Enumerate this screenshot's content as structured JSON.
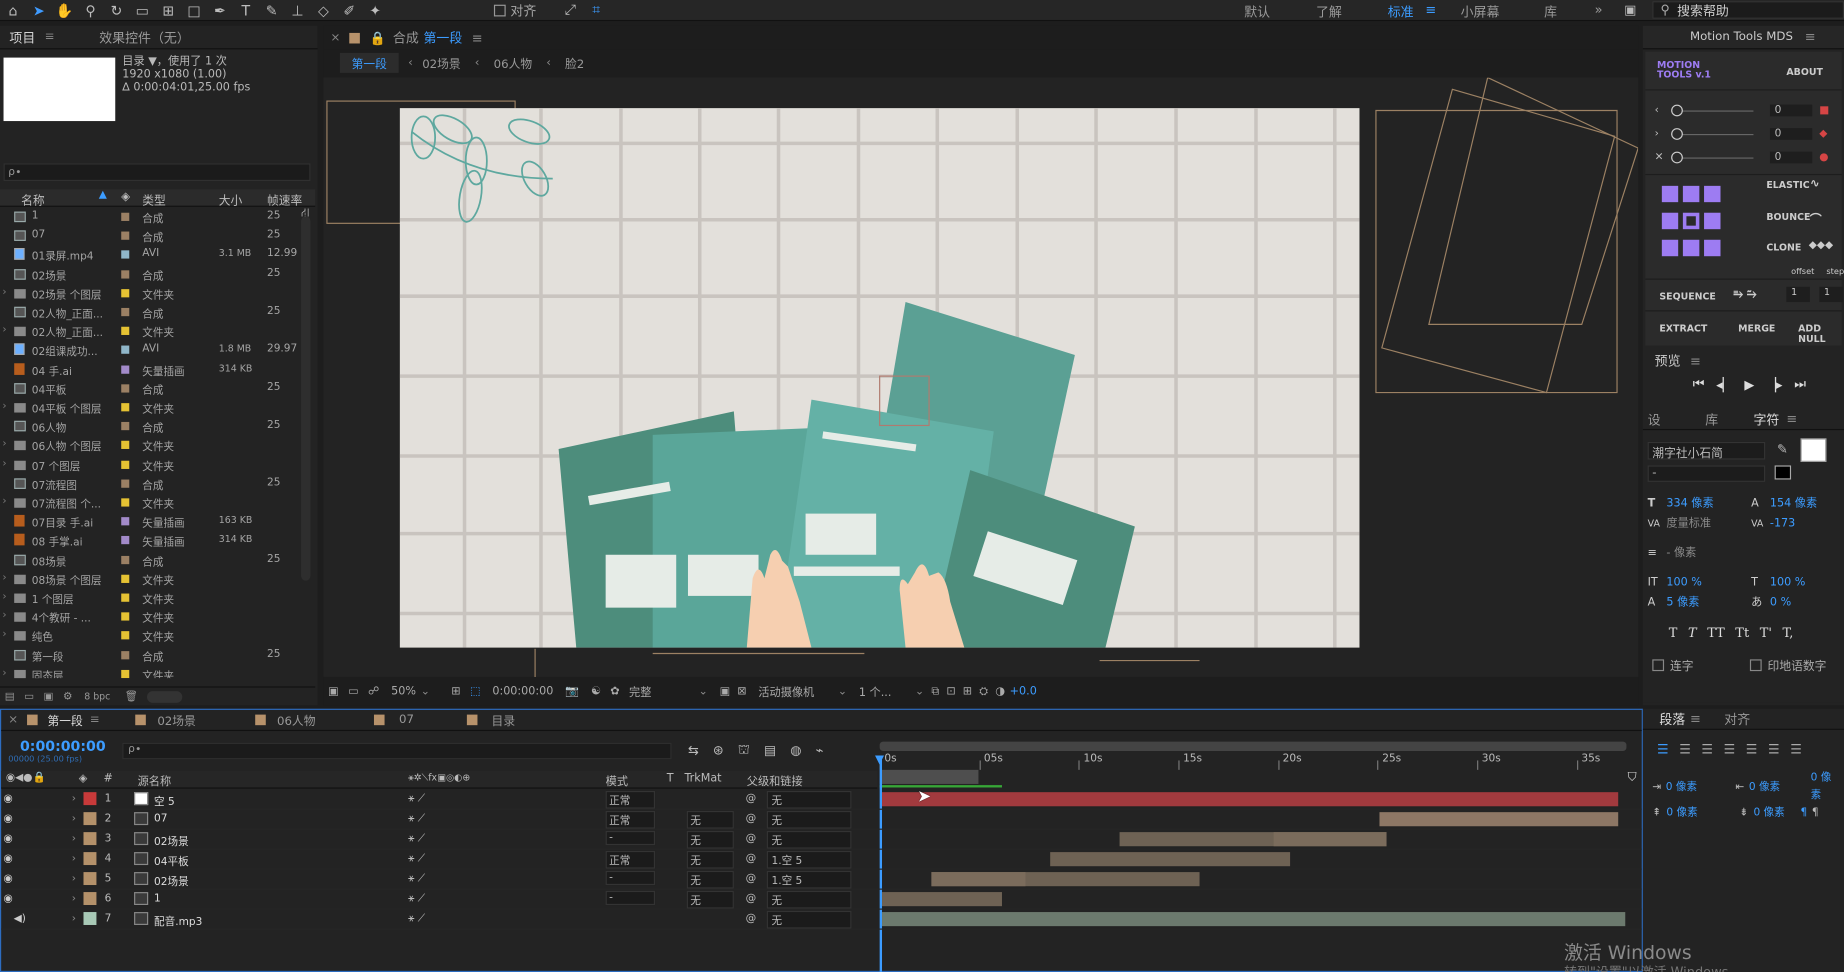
{
  "toolbar": {
    "snap_label": "对齐",
    "workspaces": [
      "默认",
      "了解",
      "标准",
      "小屏幕",
      "库"
    ],
    "search_placeholder": "搜索帮助"
  },
  "project_panel": {
    "tab_project": "项目",
    "tab_effects": "效果控件（无）",
    "comp_name": "目录 ▼，使用了 1 次",
    "comp_res": "1920 x1080 (1.00)",
    "comp_dur": "∆ 0:00:04:01,25.00 fps",
    "search_placeholder": "ρ∙",
    "columns": [
      "名称",
      "类型",
      "大小",
      "帧速率"
    ],
    "items": [
      {
        "name": "1",
        "icon": "comp",
        "color": "#9b8064",
        "type": "合成",
        "size": "",
        "fps": "25"
      },
      {
        "name": "07",
        "icon": "comp",
        "color": "#9b8064",
        "type": "合成",
        "size": "",
        "fps": "25"
      },
      {
        "name": "01录屏.mp4",
        "icon": "file",
        "color": "#8fb6c9",
        "type": "AVI",
        "size": "3.1 MB",
        "fps": "12.99"
      },
      {
        "name": "02场景",
        "icon": "comp",
        "color": "#9b8064",
        "type": "合成",
        "size": "",
        "fps": "25"
      },
      {
        "name": "02场景 个图层",
        "icon": "folder",
        "color": "#e5c233",
        "type": "文件夹",
        "size": "",
        "fps": ""
      },
      {
        "name": "02人物_正面...",
        "icon": "comp",
        "color": "#9b8064",
        "type": "合成",
        "size": "",
        "fps": "25"
      },
      {
        "name": "02人物_正面...",
        "icon": "folder",
        "color": "#e5c233",
        "type": "文件夹",
        "size": "",
        "fps": ""
      },
      {
        "name": "02组课成功...",
        "icon": "file",
        "color": "#8fb6c9",
        "type": "AVI",
        "size": "1.8 MB",
        "fps": "29.97"
      },
      {
        "name": "04 手.ai",
        "icon": "ai",
        "color": "#a28ac9",
        "type": "矢量插画",
        "size": "314 KB",
        "fps": ""
      },
      {
        "name": "04平板",
        "icon": "comp",
        "color": "#9b8064",
        "type": "合成",
        "size": "",
        "fps": "25"
      },
      {
        "name": "04平板 个图层",
        "icon": "folder",
        "color": "#e5c233",
        "type": "文件夹",
        "size": "",
        "fps": ""
      },
      {
        "name": "06人物",
        "icon": "comp",
        "color": "#9b8064",
        "type": "合成",
        "size": "",
        "fps": "25"
      },
      {
        "name": "06人物 个图层",
        "icon": "folder",
        "color": "#e5c233",
        "type": "文件夹",
        "size": "",
        "fps": ""
      },
      {
        "name": "07 个图层",
        "icon": "folder",
        "color": "#e5c233",
        "type": "文件夹",
        "size": "",
        "fps": ""
      },
      {
        "name": "07流程图",
        "icon": "comp",
        "color": "#9b8064",
        "type": "合成",
        "size": "",
        "fps": "25"
      },
      {
        "name": "07流程图 个...",
        "icon": "folder",
        "color": "#e5c233",
        "type": "文件夹",
        "size": "",
        "fps": ""
      },
      {
        "name": "07目录 手.ai",
        "icon": "ai",
        "color": "#a28ac9",
        "type": "矢量插画",
        "size": "163 KB",
        "fps": ""
      },
      {
        "name": "08 手掌.ai",
        "icon": "ai",
        "color": "#a28ac9",
        "type": "矢量插画",
        "size": "314 KB",
        "fps": ""
      },
      {
        "name": "08场景",
        "icon": "comp",
        "color": "#9b8064",
        "type": "合成",
        "size": "",
        "fps": "25"
      },
      {
        "name": "08场景 个图层",
        "icon": "folder",
        "color": "#e5c233",
        "type": "文件夹",
        "size": "",
        "fps": ""
      },
      {
        "name": "1 个图层",
        "icon": "folder",
        "color": "#e5c233",
        "type": "文件夹",
        "size": "",
        "fps": ""
      },
      {
        "name": "4个教研 - ...",
        "icon": "folder",
        "color": "#e5c233",
        "type": "文件夹",
        "size": "",
        "fps": ""
      },
      {
        "name": "纯色",
        "icon": "folder",
        "color": "#e5c233",
        "type": "文件夹",
        "size": "",
        "fps": ""
      },
      {
        "name": "第一段",
        "icon": "comp",
        "color": "#9b8064",
        "type": "合成",
        "size": "",
        "fps": "25"
      },
      {
        "name": "固态层",
        "icon": "folder",
        "color": "#e5c233",
        "type": "文件夹",
        "size": "",
        "fps": ""
      }
    ],
    "bpc": "8 bpc"
  },
  "comp_panel": {
    "title_prefix": "合成",
    "title_name": "第一段",
    "breadcrumbs": [
      "第一段",
      "02场景",
      "06人物",
      "脸2"
    ],
    "zoom": "50%",
    "timecode": "0:00:00:00",
    "quality": "完整",
    "camera": "活动摄像机",
    "views": "1 个...",
    "exposure": "+0.0"
  },
  "timeline": {
    "tabs": [
      "第一段",
      "02场景",
      "06人物",
      "07",
      "目录"
    ],
    "timecode": "0:00:00:00",
    "frame_info": "00000 (25.00 fps)",
    "search_placeholder": "ρ∙",
    "headers": {
      "name": "源名称",
      "mode": "模式",
      "t": "T",
      "trkmat": "TrkMat",
      "parent": "父级和链接"
    },
    "ruler": [
      "0s",
      "05s",
      "10s",
      "15s",
      "20s",
      "25s",
      "30s",
      "35s"
    ],
    "layers": [
      {
        "num": "1",
        "color": "#c83a3a",
        "name": "空 5",
        "mode": "正常",
        "trkmat": "",
        "parent": "无",
        "bar_color": "#a23a3e"
      },
      {
        "num": "2",
        "color": "#b4916a",
        "name": "07",
        "mode": "正常",
        "trkmat": "无",
        "parent": "无",
        "bar_color": "#8d7765"
      },
      {
        "num": "3",
        "color": "#b4916a",
        "name": "02场景",
        "mode": "-",
        "trkmat": "无",
        "parent": "无",
        "bar_color": "#6e6254"
      },
      {
        "num": "4",
        "color": "#b4916a",
        "name": "04平板",
        "mode": "正常",
        "trkmat": "无",
        "parent": "1.空 5",
        "bar_color": "#6e6254"
      },
      {
        "num": "5",
        "color": "#b4916a",
        "name": "02场景",
        "mode": "-",
        "trkmat": "无",
        "parent": "1.空 5",
        "bar_color": "#6e6254"
      },
      {
        "num": "6",
        "color": "#b4916a",
        "name": "1",
        "mode": "-",
        "trkmat": "无",
        "parent": "无",
        "bar_color": "#6e6254"
      },
      {
        "num": "7",
        "color": "#a8c9b6",
        "name": "配音.mp3",
        "mode": "",
        "trkmat": "",
        "parent": "无",
        "bar_color": "#6c7a6e"
      }
    ]
  },
  "motion_tools": {
    "title": "Motion Tools MDS",
    "logo": "MOTION TOOLS v.1",
    "about": "ABOUT",
    "values": [
      "0",
      "0",
      "0"
    ],
    "elastic": "ELASTIC",
    "bounce": "BOUNCE",
    "clone": "CLONE",
    "offset": "offset",
    "step": "step",
    "sequence": "SEQUENCE",
    "seq_values": [
      "1",
      "1"
    ],
    "extract": "EXTRACT",
    "merge": "MERGE",
    "add_null": "ADD NULL"
  },
  "preview": {
    "title": "预览"
  },
  "character": {
    "tabs": [
      "设",
      "库",
      "字符"
    ],
    "font": "潮字社小石简",
    "style": "-",
    "size": "334 像素",
    "leading": "154 像素",
    "kerning": "度量标准",
    "tracking": "-173",
    "stroke": "- 像素",
    "vscale": "100 %",
    "hscale": "100 %",
    "baseline": "5 像素",
    "tsume": "0 %",
    "styles": [
      "T",
      "T",
      "TT",
      "Tt",
      "T'",
      "T,"
    ],
    "ligatures": "连字",
    "hindi": "印地语数字"
  },
  "paragraph": {
    "tabs": [
      "段落",
      "对齐"
    ],
    "indent": [
      "0 像素",
      "0 像素",
      "0 像素",
      "0 像素",
      "0 像素"
    ]
  },
  "watermark": {
    "line1": "激活 Windows",
    "line2": "转到\"设置\"以激活 Windows。"
  }
}
